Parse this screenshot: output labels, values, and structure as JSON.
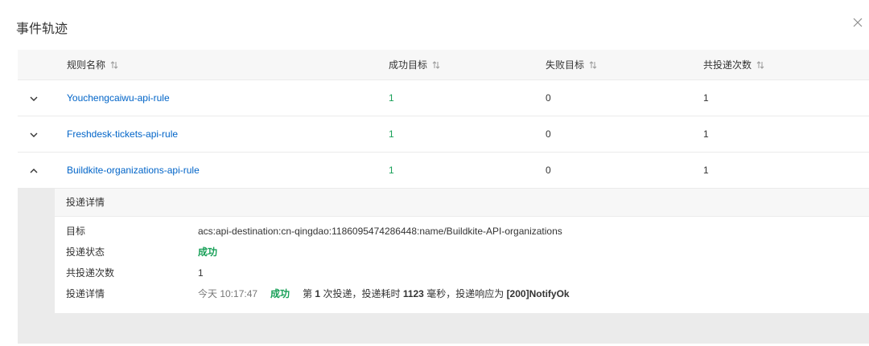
{
  "panel": {
    "title": "事件轨迹"
  },
  "table": {
    "headers": {
      "rule_name": "规则名称",
      "success_target": "成功目标",
      "failed_target": "失败目标",
      "total_deliveries": "共投递次数"
    },
    "rows": [
      {
        "rule_name": "Youchengcaiwu-api-rule",
        "success": "1",
        "failed": "0",
        "total": "1",
        "expanded": false
      },
      {
        "rule_name": "Freshdesk-tickets-api-rule",
        "success": "1",
        "failed": "0",
        "total": "1",
        "expanded": false
      },
      {
        "rule_name": "Buildkite-organizations-api-rule",
        "success": "1",
        "failed": "0",
        "total": "1",
        "expanded": true
      }
    ]
  },
  "detail": {
    "header": "投递详情",
    "target_label": "目标",
    "target_value": "acs:api-destination:cn-qingdao:1186095474286448:name/Buildkite-API-organizations",
    "status_label": "投递状态",
    "status_value": "成功",
    "count_label": "共投递次数",
    "count_value": "1",
    "info_label": "投递详情",
    "info_time": "今天 10:17:47",
    "info_status": "成功",
    "info_prefix": "第",
    "info_attempt": "1",
    "info_mid": "次投递，投递耗时",
    "info_duration": "1123",
    "info_unit": "毫秒，投递响应为",
    "info_response": "[200]NotifyOk"
  },
  "colors": {
    "link": "#0064c8",
    "success": "#18a058",
    "header_bg": "#f7f7f7",
    "expanded_bg": "#ebebeb"
  },
  "icons": {
    "close": "close-icon",
    "sort": "sort-icon",
    "collapsed": "chevron-down-icon",
    "expanded": "chevron-up-icon"
  }
}
